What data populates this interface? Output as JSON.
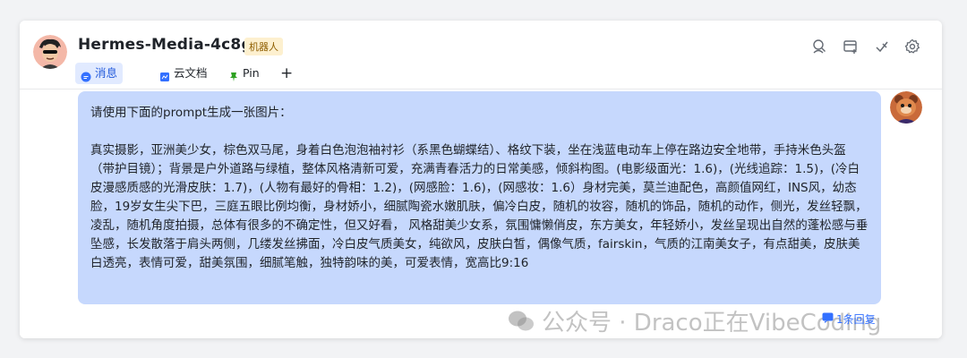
{
  "header": {
    "title": "Hermes-Media-4c8g",
    "badge": "机器人",
    "tabs": [
      {
        "label": "消息",
        "icon": "chat-bubble-icon",
        "active": true
      },
      {
        "label": "云文档",
        "icon": "doc-icon",
        "active": false
      },
      {
        "label": "Pin",
        "icon": "pin-icon",
        "active": false
      }
    ],
    "add_tab": "+",
    "actions": [
      "search-person-icon",
      "new-window-icon",
      "mark-icon",
      "settings-icon"
    ]
  },
  "message": {
    "line1": "请使用下面的prompt生成一张图片：",
    "body": "真实摄影，亚洲美少女，棕色双马尾，身着白色泡泡袖衬衫（系黑色蝴蝶结）、格纹下装，坐在浅蓝电动车上停在路边安全地带，手持米色头盔（带护目镜）；背景是户外道路与绿植，整体风格清新可爱，充满青春活力的日常美感，倾斜构图。(电影级面光：1.6)，(光线追踪：1.5)，(冷白皮漫感质感的光滑皮肤：1.7)，(人物有最好的骨相：1.2)，(网感脸：1.6)，(网感妆：1.6）身材完美，莫兰迪配色，高颜值网红，INS风，幼态脸，19岁女生尖下巴，三庭五眼比例均衡，身材娇小，细腻陶瓷水嫩肌肤，偏冷白皮，随机的妆容，随机的饰品，随机的动作，侧光，发丝轻飘，凌乱，随机角度拍摄，总体有很多的不确定性，但又好看， 风格甜美少女系，氛围慵懒俏皮，东方美女，年轻娇小，发丝呈现出自然的蓬松感与垂坠感，长发散落于肩头两侧，几缕发丝拂面，冷白皮气质美女，纯欲风，皮肤白皙，偶像气质，fairskin，气质的江南美女子，有点甜美，皮肤美白透亮，表情可爱，甜美氛围，细腻笔触，独特韵味的美，可爱表情，宽高比9:16"
  },
  "thread": {
    "label": "1条回复"
  },
  "watermark": {
    "text": "公众号 · Draco正在VibeCoding"
  },
  "colors": {
    "bubble": "#c6d8fd",
    "accent": "#3370ff",
    "badge_bg": "#fdf0cf"
  }
}
